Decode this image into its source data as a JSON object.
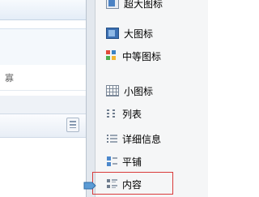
{
  "background": {
    "clipped_text": "寡"
  },
  "menu": {
    "items": [
      {
        "label": "超大图标",
        "icon": "extra-large-icons-icon"
      },
      {
        "label": "大图标",
        "icon": "large-icons-icon"
      },
      {
        "label": "中等图标",
        "icon": "medium-icons-icon"
      },
      {
        "label": "小图标",
        "icon": "small-icons-icon"
      },
      {
        "label": "列表",
        "icon": "list-icon"
      },
      {
        "label": "详细信息",
        "icon": "details-icon"
      },
      {
        "label": "平铺",
        "icon": "tiles-icon"
      },
      {
        "label": "内容",
        "icon": "content-icon"
      }
    ],
    "selected_index": 7
  },
  "colors": {
    "highlight_border": "#d93a3a",
    "pointer": "#5b9bd5"
  }
}
